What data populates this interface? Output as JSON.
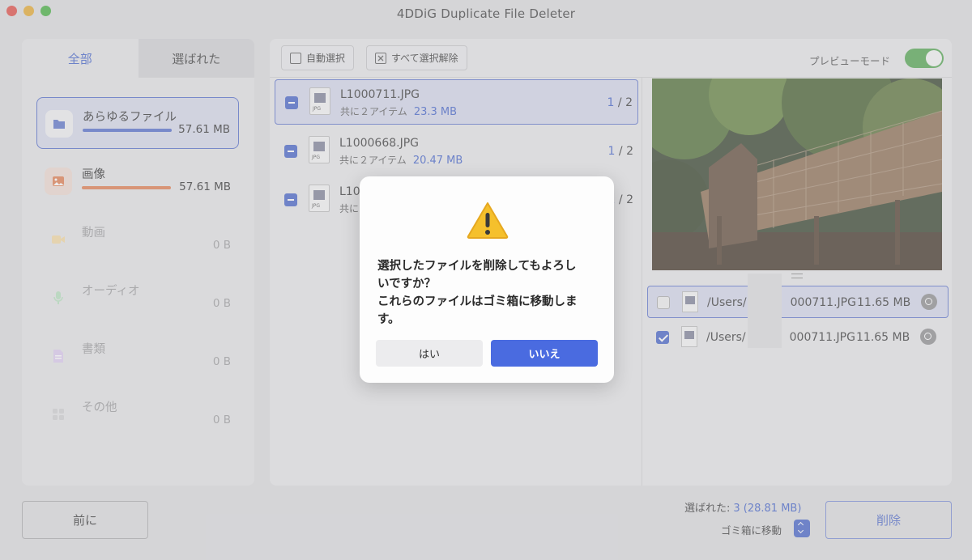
{
  "window": {
    "title": "4DDiG Duplicate File Deleter"
  },
  "left": {
    "tabs": [
      {
        "label": "全部",
        "active": true
      },
      {
        "label": "選ばれた",
        "active": false
      }
    ],
    "categories": [
      {
        "name": "あらゆるファイル",
        "size": "57.61 MB",
        "icon": "folder-icon",
        "color": "#4e67c9",
        "selected": true
      },
      {
        "name": "画像",
        "size": "57.61 MB",
        "icon": "image-icon",
        "color": "#e07a4a",
        "selected": false
      },
      {
        "name": "動画",
        "size": "0 B",
        "icon": "video-icon",
        "color": "#f0b84f",
        "selected": false
      },
      {
        "name": "オーディオ",
        "size": "0 B",
        "icon": "microphone-icon",
        "color": "#5bc26b",
        "selected": false
      },
      {
        "name": "書類",
        "size": "0 B",
        "icon": "document-icon",
        "color": "#b58be0",
        "selected": false
      },
      {
        "name": "その他",
        "size": "0 B",
        "icon": "grid-icon",
        "color": "#9a9a9c",
        "selected": false
      }
    ]
  },
  "toolbar": {
    "auto_select": "自動選択",
    "deselect_all": "すべて選択解除",
    "preview_mode": "プレビューモード",
    "preview_on": true
  },
  "files": [
    {
      "name": "L1000711.JPG",
      "items_label": "共に２アイテム",
      "size": "23.3 MB",
      "current": "1",
      "total": " / 2",
      "selected": true
    },
    {
      "name": "L1000668.JPG",
      "items_label": "共に２アイテム",
      "size": "20.47 MB",
      "current": "1",
      "total": " / 2",
      "selected": false
    },
    {
      "name": "L10",
      "items_label": "共に",
      "size": "",
      "current": "1",
      "total": " / 2",
      "selected": false
    }
  ],
  "file_icon_label": "JPG",
  "paths": [
    {
      "prefix": "/Users/",
      "suffix": "000711.JPG",
      "size": "11.65 MB",
      "checked": false,
      "selected": true
    },
    {
      "prefix": "/Users/",
      "suffix": "000711.JPG",
      "size": "11.65 MB",
      "checked": true,
      "selected": false
    }
  ],
  "bottom": {
    "prev": "前に",
    "selected_label": "選ばれた:",
    "selected_value": "3 (28.81 MB)",
    "trash_label": "ゴミ箱に移動",
    "delete": "削除"
  },
  "dialog": {
    "icon": "warning-icon",
    "message_line1": "選択したファイルを削除してもよろし",
    "message_line2": "いですか？",
    "message_line3": "これらのファイルはゴミ箱に移動しま",
    "message_line4": "す。",
    "yes": "はい",
    "no": "いいえ"
  }
}
